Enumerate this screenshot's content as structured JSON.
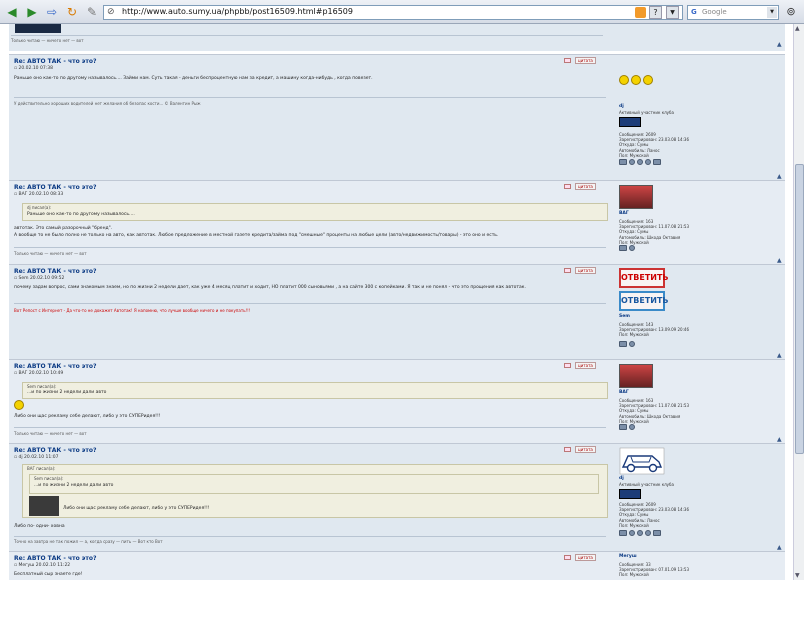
{
  "browser": {
    "url": "http://www.auto.sumy.ua/phpbb/post16509.html#p16509",
    "search_placeholder": "Google"
  },
  "top": {
    "sig": "Только читаю — ничего нет — вот"
  },
  "posts": [
    {
      "title": "Re: АВТО ТАК - что это?",
      "meta": "20.02.10 07:38",
      "quote_label": "цитата",
      "lines": [
        "Раньше оно как-то по другому называлось.... Займи нам. Суть такая - деньги беспроцентную нам за кредит, а машину когда-нибудь , когда повезет."
      ],
      "sig": "У действительно хороших водителей нет желания об безопас кости... © Валентин Рыж",
      "user": {
        "name": "dj",
        "rank": "Активный участник клуба",
        "info": [
          "Сообщения: 2609",
          "Зарегистрирован: 23.03.08 14:36",
          "Откуда: Сумы",
          "Автомобиль: Ланос",
          "Пол: Мужской"
        ]
      }
    },
    {
      "title": "Re: АВТО ТАК - что это?",
      "meta": "ВАГ 20.02.10 08:33",
      "quote_label": "цитата",
      "quote_head": "dj писал(а):",
      "quote_body": "Раньше оно как-то по другому называлось....",
      "lines": [
        "автотак. Это самый разорочный \"бренд\".",
        "А вообще то не было полно не только на авто, как автотак. Любое предложение в местной газете кредита/займа под \"смешные\" проценты на любые цели (авто/недвижимость/товары) - это оно и есть."
      ],
      "sig": "Только читаю — ничего нет — вот",
      "user": {
        "name": "ВАГ",
        "info": [
          "Сообщения: 163",
          "Зарегистрирован: 11.07.08 21:53",
          "Откуда: Сумы",
          "Автомобиль: Шкода Октавия",
          "Пол: Мужской"
        ]
      }
    },
    {
      "title": "Re: АВТО ТАК - что это?",
      "meta": "Sem 20.02.10 09:52",
      "quote_label": "цитата",
      "lines": [
        "почему задам вопрос, сами знакомым знаем, но по жизни 2 недели дает, как уже 4 месяц платит и ходит, НО платит 000 сыновьями , а на сайте 300 с копейками. Я так и не понял - что это прощения как автотак."
      ],
      "sig": "Вот Репост с Интернет - Да что-то не докажет Автотак! Я напомню, что лучше вообще ничего и не покупать!!!",
      "reply_label": "ОТВЕТИТЬ",
      "user": {
        "name": "Sem",
        "info": [
          "Сообщения: 143",
          "Зарегистрирован: 13.09.09 20:46",
          "Пол: Мужской"
        ]
      }
    },
    {
      "title": "Re: АВТО ТАК - что это?",
      "meta": "ВАГ 20.02.10 10:49",
      "quote_label": "цитата",
      "quote_head": "Sem писал(а):",
      "quote_body": "...и по жизни 2 недели дали авто",
      "lines": [
        "Либо они щас рекламу себе делают, либо у это СУПЕРидея!!!"
      ],
      "sig": "Только читаю — ничего нет — вот",
      "user": {
        "name": "ВАГ",
        "info": [
          "Сообщения: 163",
          "Зарегистрирован: 11.07.08 21:53",
          "Откуда: Сумы",
          "Автомобиль: Шкода Октавия",
          "Пол: Мужской"
        ]
      }
    },
    {
      "title": "Re: АВТО ТАК - что это?",
      "meta": "dj 20.02.10 11:07",
      "quote_label": "цитата",
      "quote_head": "ВАГ писал(а):",
      "quote_inner_head": "Sem писал(а):",
      "quote_inner_body": "...и по жизни 2 недели дали авто",
      "quote_body": "Либо они щас рекламу себе делают, либо у это СУПЕРидея!!!",
      "lines": [
        "Либо по- одни- ховна"
      ],
      "sig": "Точно на завтра не так пожил — а, когда сразу — пить — Вот кто Вот",
      "user": {
        "name": "dj",
        "rank": "Активный участник клуба",
        "info": [
          "Сообщения: 2609",
          "Зарегистрирован: 23.03.08 14:36",
          "Откуда: Сумы",
          "Автомобиль: Ланос",
          "Пол: Мужской"
        ]
      }
    },
    {
      "title": "Re: АВТО ТАК - что это?",
      "meta": "Мегуш 20.02.10 11:22",
      "quote_label": "цитата",
      "lines": [
        "Бесплатный сыр знаете где!"
      ],
      "user": {
        "name": "Мегуш",
        "info": [
          "Сообщения: 33",
          "Зарегистрирован: 07.01.09 13:53",
          "Пол: Мужской"
        ]
      }
    }
  ],
  "colors": {
    "post_bg": "#e0e8f0",
    "title": "#0b3a84",
    "quote_bg": "#f0efe0"
  }
}
